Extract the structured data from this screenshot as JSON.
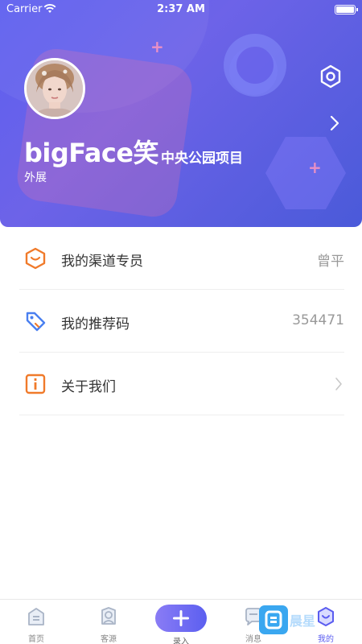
{
  "status_bar": {
    "carrier": "Carrier",
    "time": "2:37 AM"
  },
  "profile": {
    "name": "bigFace笑",
    "project": "中央公园项目",
    "role": "外展"
  },
  "menu": [
    {
      "label": "我的渠道专员",
      "value": "曾平",
      "icon": "hexagon-person-icon",
      "color": "#f07a2a"
    },
    {
      "label": "我的推荐码",
      "value": "354471",
      "icon": "tag-icon",
      "color": "#4a7ff0"
    },
    {
      "label": "关于我们",
      "value": "",
      "icon": "info-icon",
      "color": "#f07a2a"
    }
  ],
  "tabs": [
    {
      "label": "首页",
      "icon": "home-icon"
    },
    {
      "label": "客源",
      "icon": "customer-icon"
    },
    {
      "label": "录入",
      "icon": "plus-icon"
    },
    {
      "label": "消息",
      "icon": "message-icon"
    },
    {
      "label": "我的",
      "icon": "profile-icon",
      "active": true
    }
  ],
  "watermark": "晨星",
  "colors": {
    "accent": "#5a5cf0",
    "header_start": "#5d5ff0",
    "header_end": "#4a5ad9"
  }
}
